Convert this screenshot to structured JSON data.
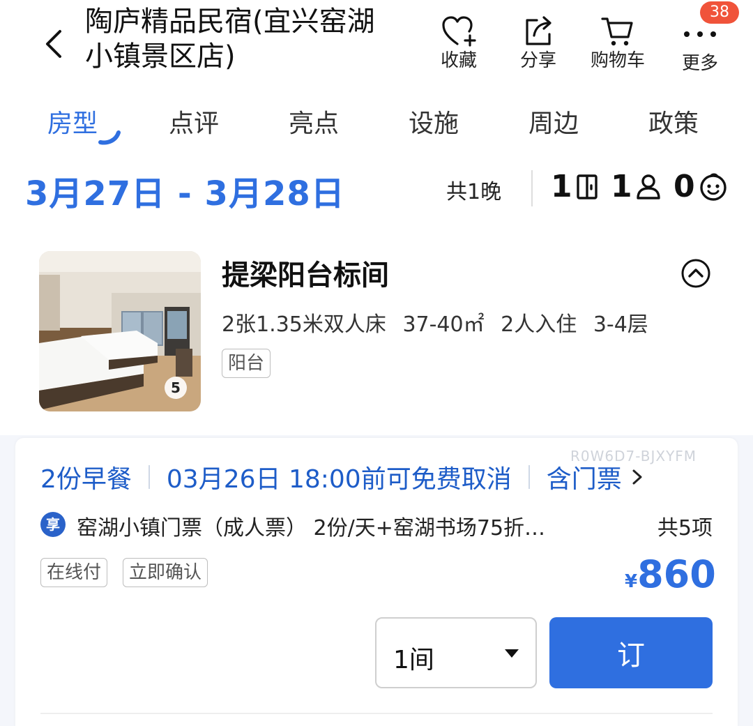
{
  "header": {
    "title_line1": "陶庐精品民宿(宜兴窑湖",
    "title_line2": "小镇景区店)",
    "actions": [
      {
        "label": "收藏",
        "icon": "heart-plus-icon"
      },
      {
        "label": "分享",
        "icon": "share-icon"
      },
      {
        "label": "购物车",
        "icon": "cart-icon"
      },
      {
        "label": "更多",
        "icon": "more-icon"
      }
    ],
    "badge": "38"
  },
  "tabs": [
    {
      "label": "房型",
      "active": true
    },
    {
      "label": "点评",
      "active": false
    },
    {
      "label": "亮点",
      "active": false
    },
    {
      "label": "设施",
      "active": false
    },
    {
      "label": "周边",
      "active": false
    },
    {
      "label": "政策",
      "active": false
    }
  ],
  "booking": {
    "dates": "3月27日 - 3月28日",
    "nights": "共1晚",
    "rooms": "1",
    "adults": "1",
    "children": "0"
  },
  "room": {
    "name": "提梁阳台标间",
    "bed": "2张1.35米双人床",
    "area": "37-40㎡",
    "occupancy": "2人入住",
    "floor": "3-4层",
    "tag": "阳台",
    "photo_count": "5"
  },
  "offer": {
    "watermark": "R0W6D7-BJXYFM",
    "breakfast": "2份早餐",
    "cancel": "03月26日 18:00前可免费取消",
    "ticket": "含门票",
    "perk_badge": "享",
    "package_desc": "窑湖小镇门票（成人票） 2份/天+窑湖书场75折…",
    "package_total": "共5项",
    "tags": [
      "在线付",
      "立即确认"
    ],
    "currency": "¥",
    "price": "860",
    "quantity": "1间",
    "book_label": "订"
  },
  "colors": {
    "accent": "#2f6fe0",
    "perk_text": "#1d5cc8",
    "badge": "#f0533a"
  }
}
